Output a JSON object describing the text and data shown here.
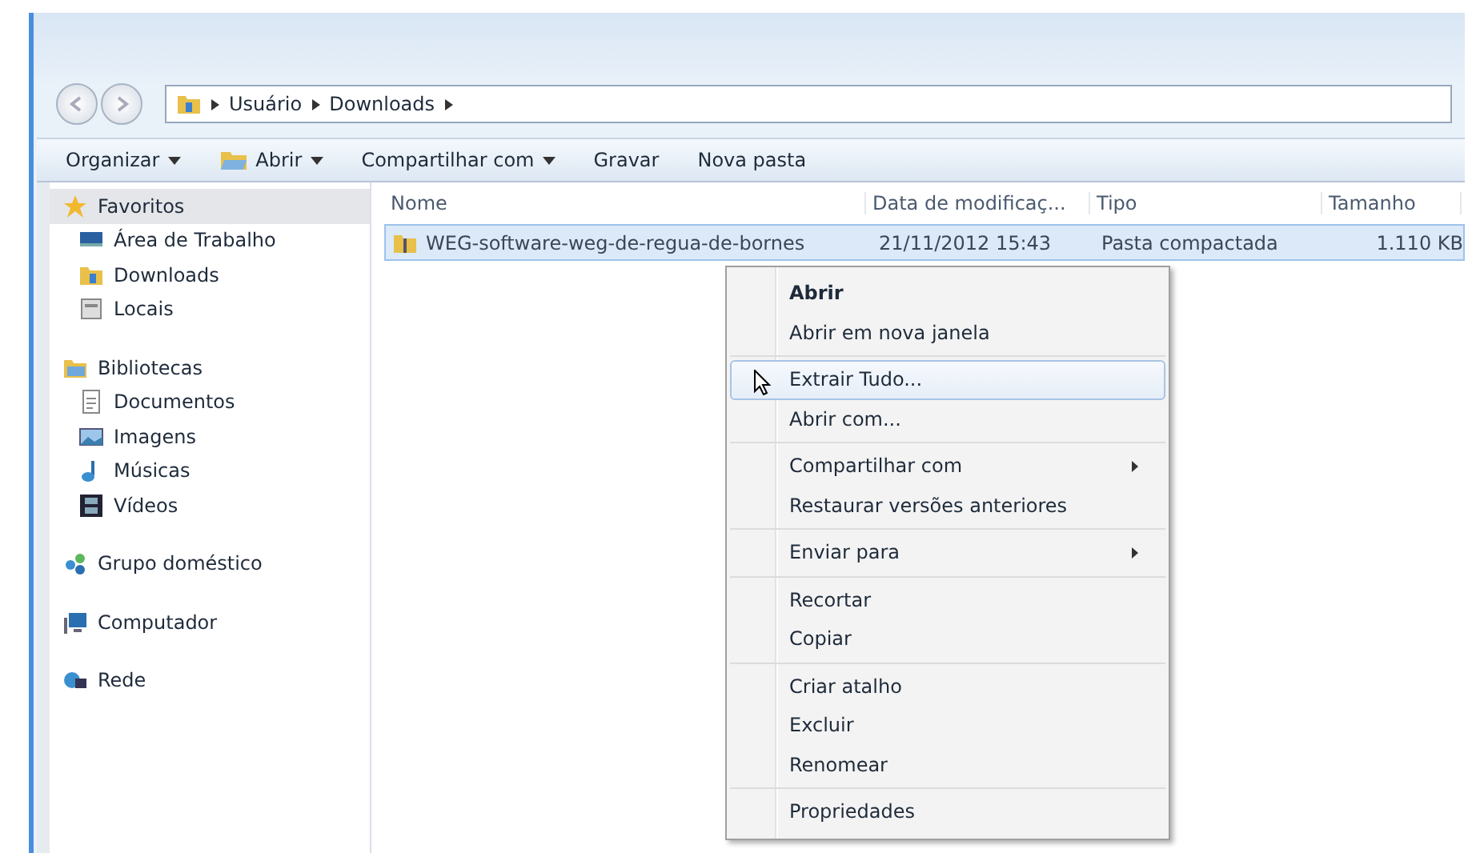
{
  "address": {
    "crumbs": [
      "Usuário",
      "Downloads"
    ]
  },
  "toolbar": [
    {
      "label": "Organizar",
      "dropdown": true
    },
    {
      "label": "Abrir",
      "dropdown": true
    },
    {
      "label": "Compartilhar com",
      "dropdown": true
    },
    {
      "label": "Gravar",
      "dropdown": false
    },
    {
      "label": "Nova pasta",
      "dropdown": false
    }
  ],
  "sidebar": [
    {
      "label": "Favoritos",
      "selected": true,
      "children": [
        {
          "label": "Área de Trabalho",
          "selected": false
        },
        {
          "label": "Downloads",
          "selected": false
        },
        {
          "label": "Locais",
          "selected": false
        }
      ]
    },
    {
      "label": "Bibliotecas",
      "selected": false,
      "children": [
        {
          "label": "Documentos",
          "selected": false
        },
        {
          "label": "Imagens",
          "selected": false
        },
        {
          "label": "Músicas",
          "selected": false
        },
        {
          "label": "Vídeos",
          "selected": false
        }
      ]
    },
    {
      "label": "Grupo doméstico",
      "selected": false
    },
    {
      "label": "Computador",
      "selected": false
    },
    {
      "label": "Rede",
      "selected": false
    }
  ],
  "table": {
    "columns": [
      "Nome",
      "Data de modificaç...",
      "Tipo",
      "Tamanho"
    ],
    "rows": [
      {
        "name": "WEG-software-weg-de-regua-de-bornes",
        "date": "21/11/2012 15:43",
        "type": "Pasta compactada",
        "size": "1.110 KB",
        "selected": true
      }
    ]
  },
  "context_menu": [
    [
      {
        "label": "Abrir",
        "default": true,
        "submenu": false,
        "selected": false
      },
      {
        "label": "Abrir em nova janela",
        "default": false,
        "submenu": false,
        "selected": false
      }
    ],
    [
      {
        "label": "Extrair Tudo...",
        "default": false,
        "submenu": false,
        "selected": true
      },
      {
        "label": "Abrir com...",
        "default": false,
        "submenu": false,
        "selected": false
      }
    ],
    [
      {
        "label": "Compartilhar com",
        "default": false,
        "submenu": true,
        "selected": false
      },
      {
        "label": "Restaurar versões anteriores",
        "default": false,
        "submenu": false,
        "selected": false
      }
    ],
    [
      {
        "label": "Enviar para",
        "default": false,
        "submenu": true,
        "selected": false
      }
    ],
    [
      {
        "label": "Recortar",
        "default": false,
        "submenu": false,
        "selected": false
      },
      {
        "label": "Copiar",
        "default": false,
        "submenu": false,
        "selected": false
      }
    ],
    [
      {
        "label": "Criar atalho",
        "default": false,
        "submenu": false,
        "selected": false
      },
      {
        "label": "Excluir",
        "default": false,
        "submenu": false,
        "selected": false
      },
      {
        "label": "Renomear",
        "default": false,
        "submenu": false,
        "selected": false
      }
    ],
    [
      {
        "label": "Propriedades",
        "default": false,
        "submenu": false,
        "selected": false
      }
    ]
  ]
}
